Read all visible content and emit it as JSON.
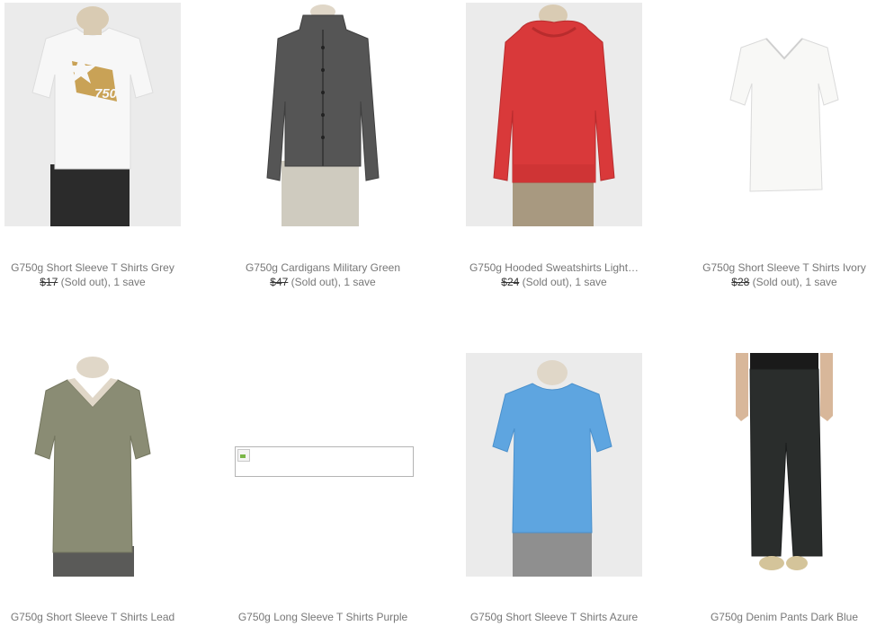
{
  "products": [
    {
      "title": "G750g Short Sleeve T Shirts Grey",
      "price": "$17",
      "status": "(Sold out), 1 save",
      "image": "white-tshirt-gold-star-print"
    },
    {
      "title": "G750g Cardigans Military Green",
      "price": "$47",
      "status": "(Sold out), 1 save",
      "image": "dark-grey-cardigan"
    },
    {
      "title": "G750g Hooded Sweatshirts Light…",
      "price": "$24",
      "status": "(Sold out), 1 save",
      "image": "red-hooded-sweatshirt"
    },
    {
      "title": "G750g Short Sleeve T Shirts Ivory",
      "price": "$28",
      "status": "(Sold out), 1 save",
      "image": "ivory-v-neck-tshirt"
    },
    {
      "title": "G750g Short Sleeve T Shirts Lead",
      "image": "olive-v-neck-tshirt"
    },
    {
      "title": "G750g Long Sleeve T Shirts Purple",
      "image": "broken-image-icon"
    },
    {
      "title": "G750g Short Sleeve T Shirts Azure",
      "image": "blue-tshirt"
    },
    {
      "title": "G750g Denim Pants Dark Blue",
      "image": "dark-denim-pants"
    }
  ]
}
